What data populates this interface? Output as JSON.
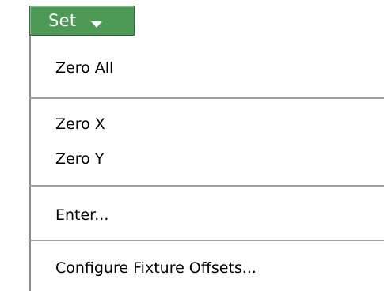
{
  "set_button": {
    "label": "Set",
    "icon": "caret-down-icon",
    "color": "#4c9a55"
  },
  "menu": {
    "items": [
      {
        "label": "Zero All"
      },
      {
        "label": "Zero X"
      },
      {
        "label": "Zero Y"
      },
      {
        "label": "Enter..."
      },
      {
        "label": "Configure Fixture Offsets..."
      }
    ]
  }
}
